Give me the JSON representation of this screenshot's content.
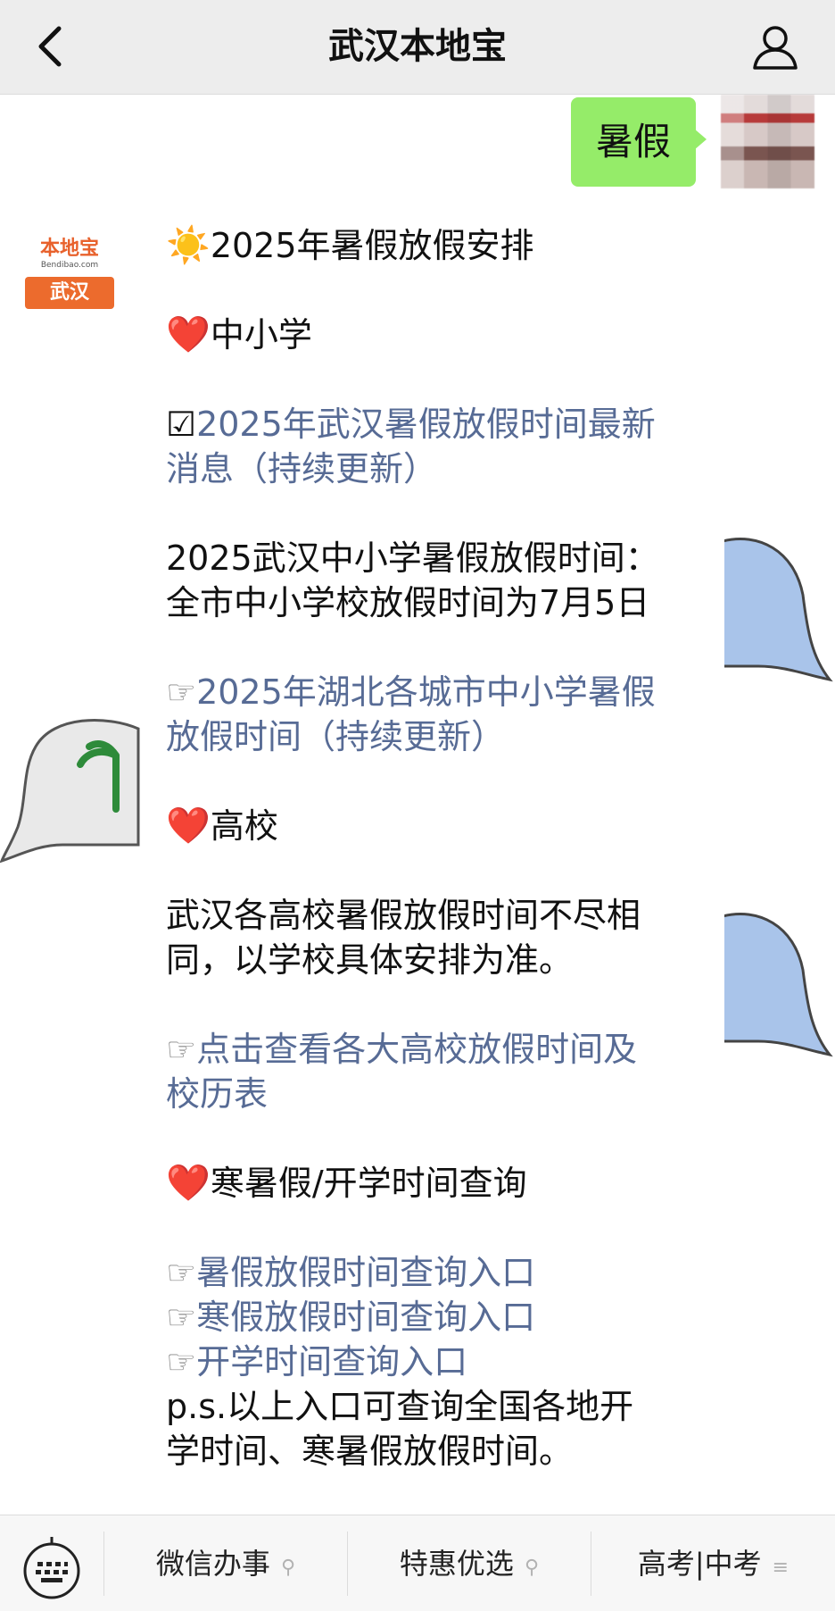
{
  "header": {
    "title": "武汉本地宝"
  },
  "user_message": {
    "text": "暑假"
  },
  "bot": {
    "logo_top": "本地宝",
    "logo_sub": "Bendibao.com",
    "logo_city": "武汉"
  },
  "article": {
    "heading_icon": "☀️",
    "heading": "2025年暑假放假安排",
    "section1_icon": "❤️",
    "section1": "中小学",
    "link1_icon": "☑",
    "link1_l1": "2025年武汉暑假放假时间最新",
    "link1_l2": "消息（持续更新）",
    "text1_l1": "2025武汉中小学暑假放假时间：",
    "text1_l2": "全市中小学校放假时间为7月5日",
    "link2_icon": "☞",
    "link2_l1": "2025年湖北各城市中小学暑假",
    "link2_l2": "放假时间（持续更新）",
    "section2_icon": "❤️",
    "section2": "高校",
    "text2_l1": "武汉各高校暑假放假时间不尽相",
    "text2_l2": "同，以学校具体安排为准。",
    "link3_icon": "☞",
    "link3_l1": "点击查看各大高校放假时间及",
    "link3_l2": "校历表",
    "section3_icon": "❤️",
    "section3": "寒暑假/开学时间查询",
    "link4_icon": "☞",
    "link4": "暑假放假时间查询入口",
    "link5_icon": "☞",
    "link5": "寒假放假时间查询入口",
    "link6_icon": "☞",
    "link6": "开学时间查询入口",
    "note_l1": "p.s.以上入口可查询全国各地开",
    "note_l2": "学时间、寒暑假放假时间。"
  },
  "menu": {
    "item1": "微信办事",
    "item2": "特惠优选",
    "item3": "高考|中考",
    "item1_icon": "link-icon",
    "item2_icon": "link-icon",
    "item3_icon": "list-icon"
  },
  "colors": {
    "header_bg": "#ededed",
    "user_bubble": "#95ec69",
    "link": "#576b95",
    "logo_orange": "#ec6b2d"
  }
}
